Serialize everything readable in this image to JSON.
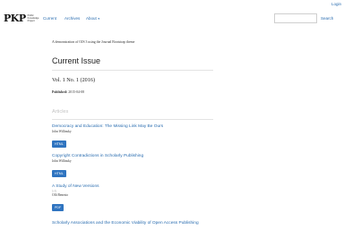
{
  "header": {
    "login_label": "Login"
  },
  "nav": {
    "logo_mark": "PKP",
    "logo_text": "Public Knowledge Project",
    "items": [
      {
        "label": "Current"
      },
      {
        "label": "Archives"
      },
      {
        "label": "About"
      }
    ],
    "search_label": "Search"
  },
  "main": {
    "intro": "A demonstration of OJS 3 using the Journal Bootstrap theme",
    "page_title": "Current Issue",
    "issue": "Vol. 1 No. 1 (2016)",
    "published_label": "Published:",
    "published_date": "2015-04-08",
    "articles_heading": "Articles",
    "articles": [
      {
        "title": "Democracy and Education: The Missing Link May Be Ours",
        "author": "John Willinsky",
        "pages": "",
        "galley": "HTML"
      },
      {
        "title": "Copyright Contradictions in Scholarly Publishing",
        "author": "John Willinsky",
        "pages": "",
        "galley": "HTML"
      },
      {
        "title": "A Study of New Versions",
        "author": "Olli Benesto",
        "pages": "1-5",
        "galley": "PDF"
      },
      {
        "title": "Scholarly Associations and the Economic Viability of Open Access Publishing",
        "author": "",
        "pages": "",
        "galley": ""
      }
    ]
  }
}
